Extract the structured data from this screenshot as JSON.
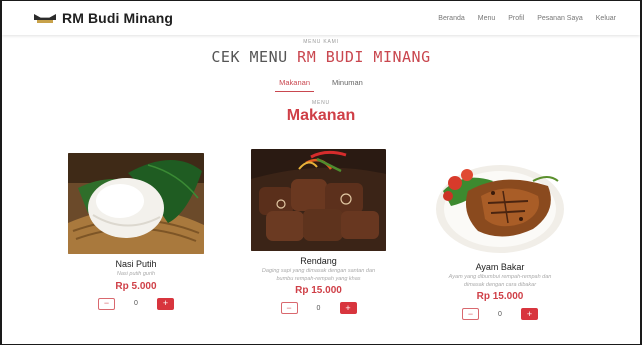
{
  "navbar": {
    "brand": "RM Budi Minang",
    "links": [
      "Beranda",
      "Menu",
      "Profil",
      "Pesanan Saya",
      "Keluar"
    ]
  },
  "header": {
    "eyebrow": "MENU KAMI",
    "title_prefix": "CEK MENU",
    "title_accent": "RM BUDI MINANG"
  },
  "tabs": [
    {
      "label": "Makanan",
      "active": true
    },
    {
      "label": "Minuman",
      "active": false
    }
  ],
  "category": {
    "eyebrow": "MENU",
    "title": "Makanan"
  },
  "products": [
    {
      "name": "Nasi Putih",
      "description": "Nasi putih gurih",
      "price": "Rp 5.000",
      "quantity": "0",
      "minus": "−",
      "plus": "+"
    },
    {
      "name": "Rendang",
      "description": "Daging sapi yang dimasak dengan santan dan bumbu rempah-rempah yang khas",
      "price": "Rp 15.000",
      "quantity": "0",
      "minus": "−",
      "plus": "+"
    },
    {
      "name": "Ayam Bakar",
      "description": "Ayam yang dibumbui rempah-rempah dan dimasak dengan cara dibakar",
      "price": "Rp 15.000",
      "quantity": "0",
      "minus": "−",
      "plus": "+"
    }
  ],
  "colors": {
    "accent": "#cf3f47",
    "button_red": "#d8353e",
    "text_dark": "#222222",
    "muted": "#aaaaaa"
  }
}
